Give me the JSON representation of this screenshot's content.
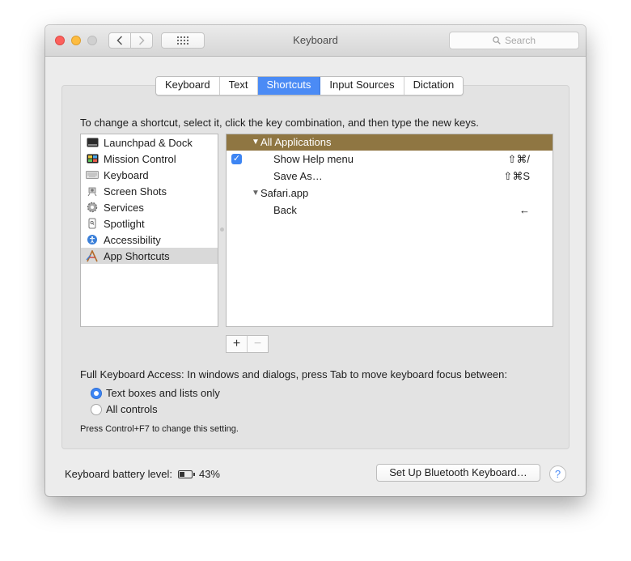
{
  "window": {
    "title": "Keyboard"
  },
  "search": {
    "placeholder": "Search"
  },
  "tabs": [
    {
      "label": "Keyboard"
    },
    {
      "label": "Text"
    },
    {
      "label": "Shortcuts",
      "active": true
    },
    {
      "label": "Input Sources"
    },
    {
      "label": "Dictation"
    }
  ],
  "instructions": "To change a shortcut, select it, click the key combination, and then type the new keys.",
  "categories": [
    {
      "label": "Launchpad & Dock",
      "icon": "launchpad-dock-icon"
    },
    {
      "label": "Mission Control",
      "icon": "mission-control-icon"
    },
    {
      "label": "Keyboard",
      "icon": "keyboard-icon"
    },
    {
      "label": "Screen Shots",
      "icon": "screenshot-icon"
    },
    {
      "label": "Services",
      "icon": "gear-icon"
    },
    {
      "label": "Spotlight",
      "icon": "spotlight-icon"
    },
    {
      "label": "Accessibility",
      "icon": "accessibility-icon"
    },
    {
      "label": "App Shortcuts",
      "icon": "app-shortcuts-icon",
      "selected": true
    }
  ],
  "shortcuts": {
    "all_apps_header": "All Applications",
    "show_help": {
      "label": "Show Help menu",
      "keys": "⇧⌘/",
      "checked": true
    },
    "save_as": {
      "label": "Save As…",
      "keys": "⇧⌘S"
    },
    "safari_group": "Safari.app",
    "back": {
      "label": "Back",
      "keys": "←"
    }
  },
  "buttons": {
    "add": "+",
    "remove": "−"
  },
  "full_keyboard_access": {
    "label": "Full Keyboard Access: In windows and dialogs, press Tab to move keyboard focus between:",
    "options": [
      {
        "label": "Text boxes and lists only",
        "selected": true
      },
      {
        "label": "All controls",
        "selected": false
      }
    ],
    "hint": "Press Control+F7 to change this setting."
  },
  "battery": {
    "label": "Keyboard battery level:",
    "percent_text": "43%",
    "level": 0.43
  },
  "bluetooth_button": "Set Up Bluetooth Keyboard…",
  "help_button": "?",
  "colors": {
    "accent": "#4b8bf5",
    "header_row": "#8f7642",
    "selected_row": "#d9d9d9"
  }
}
